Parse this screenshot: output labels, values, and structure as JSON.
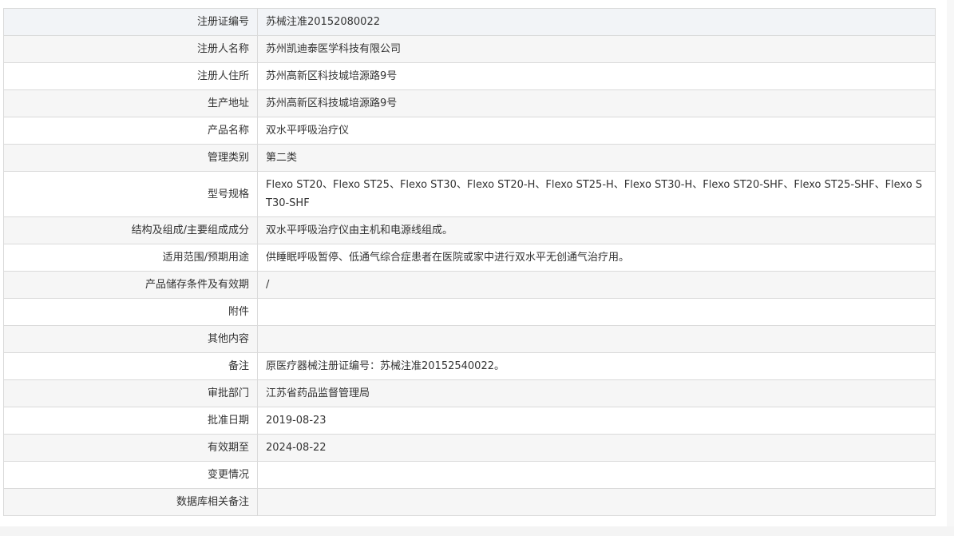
{
  "record": {
    "rows": [
      {
        "label": "注册证编号",
        "value": "苏械注准20152080022"
      },
      {
        "label": "注册人名称",
        "value": "苏州凯迪泰医学科技有限公司"
      },
      {
        "label": "注册人住所",
        "value": "苏州高新区科技城培源路9号"
      },
      {
        "label": "生产地址",
        "value": "苏州高新区科技城培源路9号"
      },
      {
        "label": "产品名称",
        "value": "双水平呼吸治疗仪"
      },
      {
        "label": "管理类别",
        "value": "第二类"
      },
      {
        "label": "型号规格",
        "value": "Flexo ST20、Flexo ST25、Flexo ST30、Flexo ST20-H、Flexo ST25-H、Flexo ST30-H、Flexo ST20-SHF、Flexo ST25-SHF、Flexo ST30-SHF"
      },
      {
        "label": "结构及组成/主要组成成分",
        "value": "双水平呼吸治疗仪由主机和电源线组成。"
      },
      {
        "label": "适用范围/预期用途",
        "value": "供睡眠呼吸暂停、低通气综合症患者在医院或家中进行双水平无创通气治疗用。"
      },
      {
        "label": "产品储存条件及有效期",
        "value": "/"
      },
      {
        "label": "附件",
        "value": ""
      },
      {
        "label": "其他内容",
        "value": ""
      },
      {
        "label": "备注",
        "value": "原医疗器械注册证编号：苏械注准20152540022。"
      },
      {
        "label": "审批部门",
        "value": "江苏省药品监督管理局"
      },
      {
        "label": "批准日期",
        "value": "2019-08-23"
      },
      {
        "label": "有效期至",
        "value": "2024-08-22"
      },
      {
        "label": "变更情况",
        "value": ""
      },
      {
        "label": "数据库相关备注",
        "value": ""
      }
    ]
  }
}
